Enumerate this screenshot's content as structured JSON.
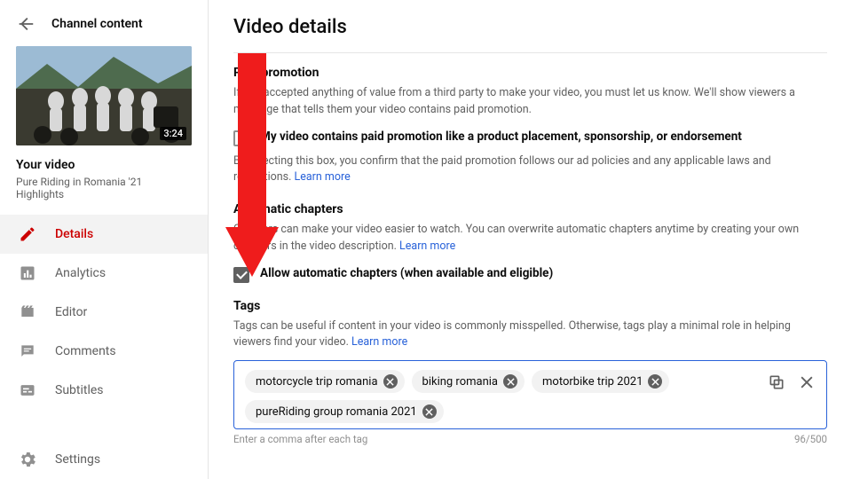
{
  "sidebar": {
    "header_title": "Channel content",
    "duration": "3:24",
    "your_video_label": "Your video",
    "video_title": "Pure Riding in Romania '21 Highlights",
    "nav": [
      {
        "label": "Details",
        "active": true,
        "icon": "pencil"
      },
      {
        "label": "Analytics",
        "active": false,
        "icon": "bar"
      },
      {
        "label": "Editor",
        "active": false,
        "icon": "clapper"
      },
      {
        "label": "Comments",
        "active": false,
        "icon": "comment"
      },
      {
        "label": "Subtitles",
        "active": false,
        "icon": "subtitles"
      }
    ],
    "settings_label": "Settings"
  },
  "main": {
    "title": "Video details",
    "paid": {
      "heading": "Paid promotion",
      "desc": "If you accepted anything of value from a third party to make your video, you must let us know. We'll show viewers a message that tells them your video contains paid promotion.",
      "checkbox_label": "My video contains paid promotion like a product placement, sponsorship, or endorsement",
      "note_prefix": "By selecting this box, you confirm that the paid promotion follows our ad policies and any applicable laws and regulations. ",
      "learn_more": "Learn more"
    },
    "chapters": {
      "heading": "Automatic chapters",
      "desc_prefix": "Chapters can make your video easier to watch. You can overwrite automatic chapters anytime by creating your own chapters in the video description. ",
      "learn_more": "Learn more",
      "checkbox_label": "Allow automatic chapters (when available and eligible)"
    },
    "tags": {
      "heading": "Tags",
      "desc_prefix": "Tags can be useful if content in your video is commonly misspelled. Otherwise, tags play a minimal role in helping viewers find your video. ",
      "learn_more": "Learn more",
      "items": [
        "motorcycle trip romania",
        "biking romania",
        "motorbike trip 2021",
        "pureRiding group romania 2021"
      ],
      "helper": "Enter a comma after each tag",
      "counter": "96/500"
    }
  }
}
